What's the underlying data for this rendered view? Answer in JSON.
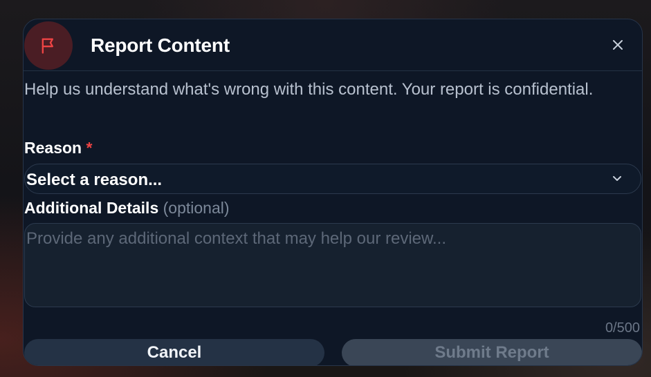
{
  "dialog": {
    "title": "Report Content",
    "description": "Help us understand what's wrong with this content. Your report is confidential.",
    "icons": {
      "header": "flag-icon",
      "close": "close-icon",
      "dropdown": "chevron-down-icon"
    }
  },
  "reason": {
    "label": "Reason",
    "required_marker": "*",
    "selected": "Select a reason..."
  },
  "details": {
    "label": "Additional Details",
    "optional_hint": "(optional)",
    "placeholder": "Provide any additional context that may help our review...",
    "counter": "0/500"
  },
  "actions": {
    "cancel_label": "Cancel",
    "submit_label": "Submit Report"
  },
  "colors": {
    "accent_danger": "#ef4444",
    "modal_bg": "#0e1726",
    "submit_disabled_bg": "#3a4656"
  }
}
